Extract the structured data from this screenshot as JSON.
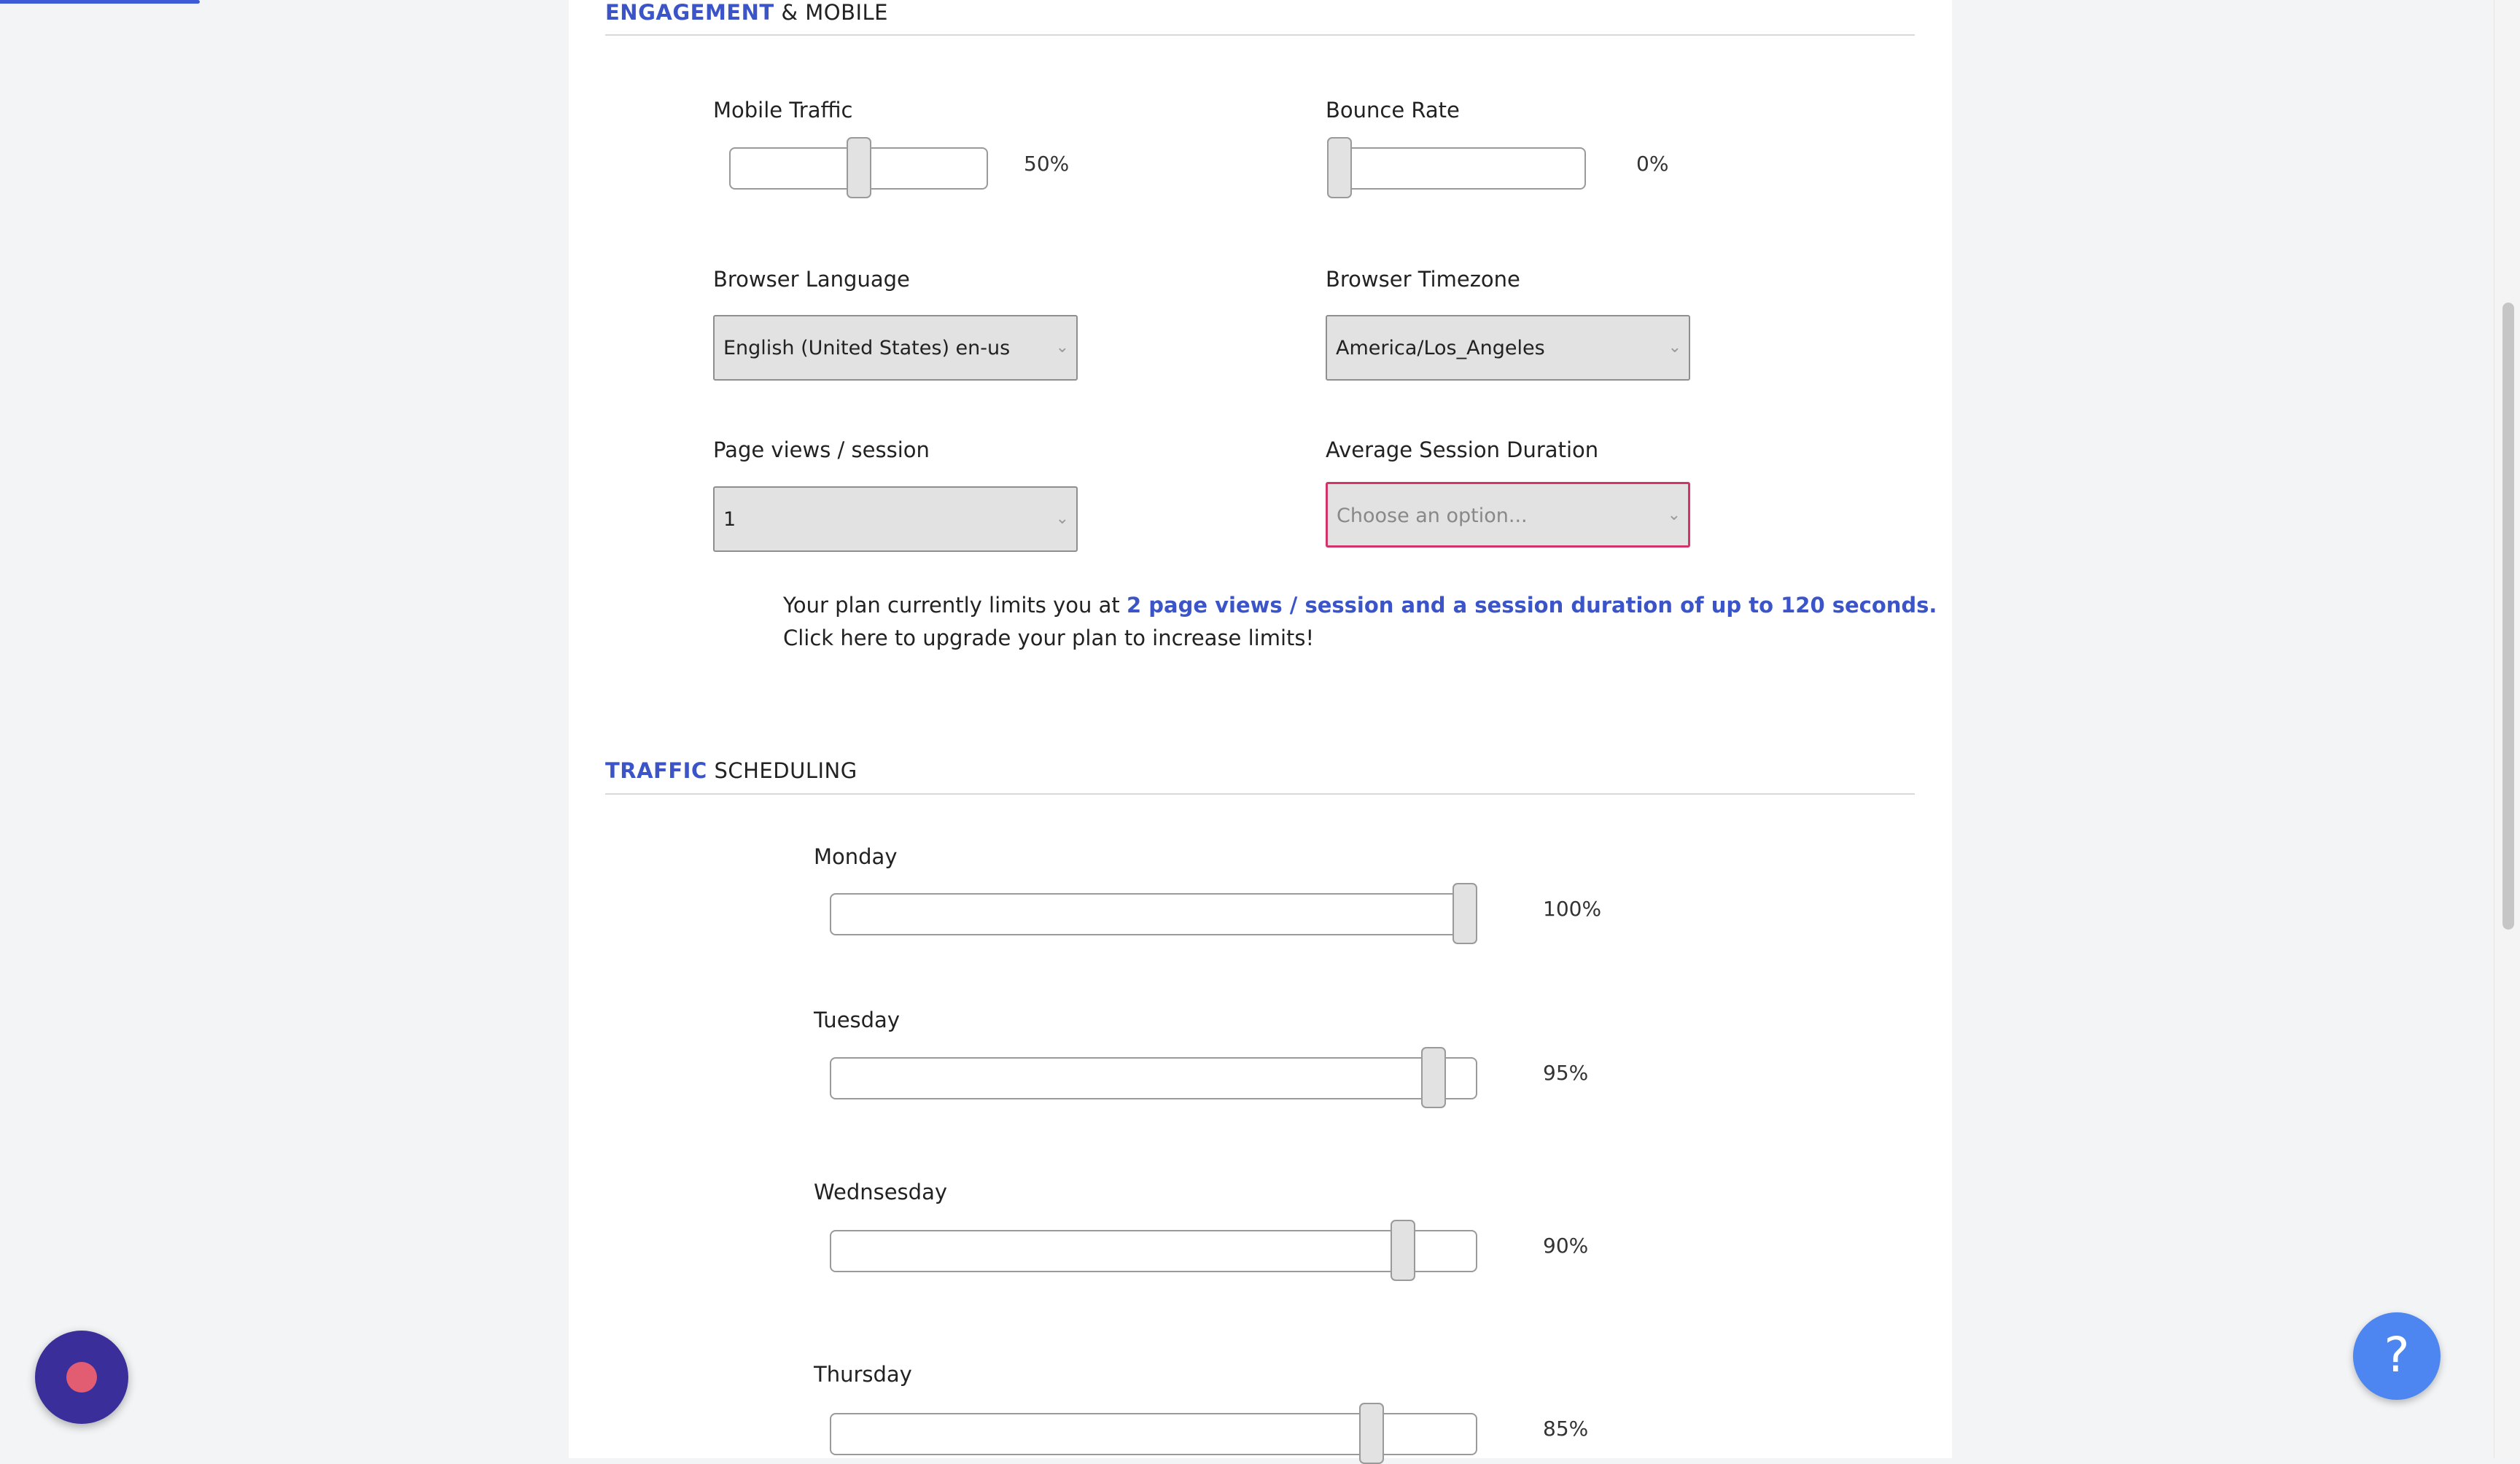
{
  "engagement_section": {
    "title_accent": "ENGAGEMENT",
    "title_rest": "& MOBILE",
    "mobile_traffic": {
      "label": "Mobile Traffic",
      "value_text": "50%",
      "value": 50
    },
    "bounce_rate": {
      "label": "Bounce Rate",
      "value_text": "0%",
      "value": 0
    },
    "browser_language": {
      "label": "Browser Language",
      "selected": "English (United States) en-us"
    },
    "browser_timezone": {
      "label": "Browser Timezone",
      "selected": "America/Los_Angeles"
    },
    "page_views": {
      "label": "Page views / session",
      "selected": "1"
    },
    "session_duration": {
      "label": "Average Session Duration",
      "placeholder": "Choose an option..."
    },
    "plan_note": {
      "prefix": "Your plan currently limits you at ",
      "highlight": "2 page views / session and a session duration of up to 120 seconds.",
      "line2": "Click here to upgrade your plan to increase limits!"
    }
  },
  "scheduling_section": {
    "title_accent": "TRAFFIC",
    "title_rest": "SCHEDULING",
    "days": [
      {
        "label": "Monday",
        "value_text": "100%",
        "value": 100
      },
      {
        "label": "Tuesday",
        "value_text": "95%",
        "value": 95
      },
      {
        "label": "Wednsesday",
        "value_text": "90%",
        "value": 90
      },
      {
        "label": "Thursday",
        "value_text": "85%",
        "value": 85
      }
    ]
  },
  "help_button": {
    "icon": "question-mark-icon",
    "glyph": "?"
  },
  "colors": {
    "accent": "#3b55c9",
    "help": "#4d86f0",
    "chat": "#3a2f9a",
    "invalid_border": "#d1336a"
  }
}
